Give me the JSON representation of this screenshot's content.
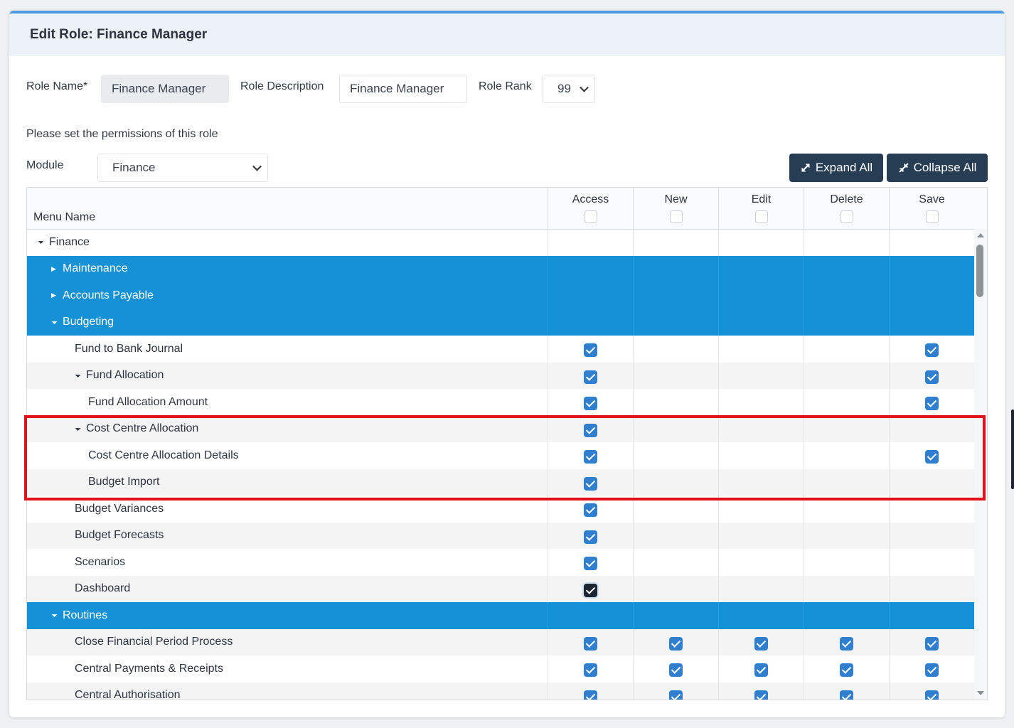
{
  "dialog": {
    "title": "Edit Role: Finance Manager"
  },
  "form": {
    "role_name_label": "Role Name*",
    "role_name_value": "Finance Manager",
    "role_desc_label": "Role Description",
    "role_desc_value": "Finance Manager",
    "role_rank_label": "Role Rank",
    "role_rank_value": "99",
    "permissions_text": "Please set the permissions of this role",
    "module_label": "Module",
    "module_value": "Finance"
  },
  "toolbar": {
    "expand_all": "Expand All",
    "collapse_all": "Collapse All"
  },
  "grid": {
    "menu_header": "Menu Name",
    "columns": [
      "Access",
      "New",
      "Edit",
      "Delete",
      "Save"
    ],
    "rows": [
      {
        "name": "Finance",
        "level": 0,
        "toggle": "down",
        "selected": false,
        "checks": [
          false,
          false,
          false,
          false,
          false
        ]
      },
      {
        "name": "Maintenance",
        "level": 1,
        "toggle": "right",
        "selected": true,
        "checks": [
          false,
          false,
          false,
          false,
          false
        ]
      },
      {
        "name": "Accounts Payable",
        "level": 1,
        "toggle": "right",
        "selected": true,
        "checks": [
          false,
          false,
          false,
          false,
          false
        ]
      },
      {
        "name": "Budgeting",
        "level": 1,
        "toggle": "down",
        "selected": true,
        "checks": [
          false,
          false,
          false,
          false,
          false
        ]
      },
      {
        "name": "Fund to Bank Journal",
        "level": 2,
        "toggle": "",
        "selected": false,
        "checks": [
          true,
          false,
          false,
          false,
          true
        ]
      },
      {
        "name": "Fund Allocation",
        "level": 2,
        "toggle": "down",
        "selected": false,
        "checks": [
          true,
          false,
          false,
          false,
          true
        ]
      },
      {
        "name": "Fund Allocation Amount",
        "level": 3,
        "toggle": "",
        "selected": false,
        "checks": [
          true,
          false,
          false,
          false,
          true
        ]
      },
      {
        "name": "Cost Centre Allocation",
        "level": 2,
        "toggle": "down",
        "selected": false,
        "checks": [
          true,
          false,
          false,
          false,
          false
        ]
      },
      {
        "name": "Cost Centre Allocation Details",
        "level": 3,
        "toggle": "",
        "selected": false,
        "checks": [
          true,
          false,
          false,
          false,
          true
        ]
      },
      {
        "name": "Budget Import",
        "level": 3,
        "toggle": "",
        "selected": false,
        "checks": [
          true,
          false,
          false,
          false,
          false
        ]
      },
      {
        "name": "Budget Variances",
        "level": 2,
        "toggle": "",
        "selected": false,
        "checks": [
          true,
          false,
          false,
          false,
          false
        ]
      },
      {
        "name": "Budget Forecasts",
        "level": 2,
        "toggle": "",
        "selected": false,
        "checks": [
          true,
          false,
          false,
          false,
          false
        ]
      },
      {
        "name": "Scenarios",
        "level": 2,
        "toggle": "",
        "selected": false,
        "checks": [
          true,
          false,
          false,
          false,
          false
        ]
      },
      {
        "name": "Dashboard",
        "level": 2,
        "toggle": "",
        "selected": false,
        "focus": true,
        "checks": [
          true,
          false,
          false,
          false,
          false
        ]
      },
      {
        "name": "Routines",
        "level": 1,
        "toggle": "down",
        "selected": true,
        "checks": [
          false,
          false,
          false,
          false,
          false
        ]
      },
      {
        "name": "Close Financial Period Process",
        "level": 2,
        "toggle": "",
        "selected": false,
        "checks": [
          true,
          true,
          true,
          true,
          true
        ]
      },
      {
        "name": "Central Payments & Receipts",
        "level": 2,
        "toggle": "",
        "selected": false,
        "checks": [
          true,
          true,
          true,
          true,
          true
        ]
      },
      {
        "name": "Central Authorisation",
        "level": 2,
        "toggle": "",
        "selected": false,
        "checks": [
          true,
          true,
          true,
          true,
          true
        ]
      }
    ]
  }
}
